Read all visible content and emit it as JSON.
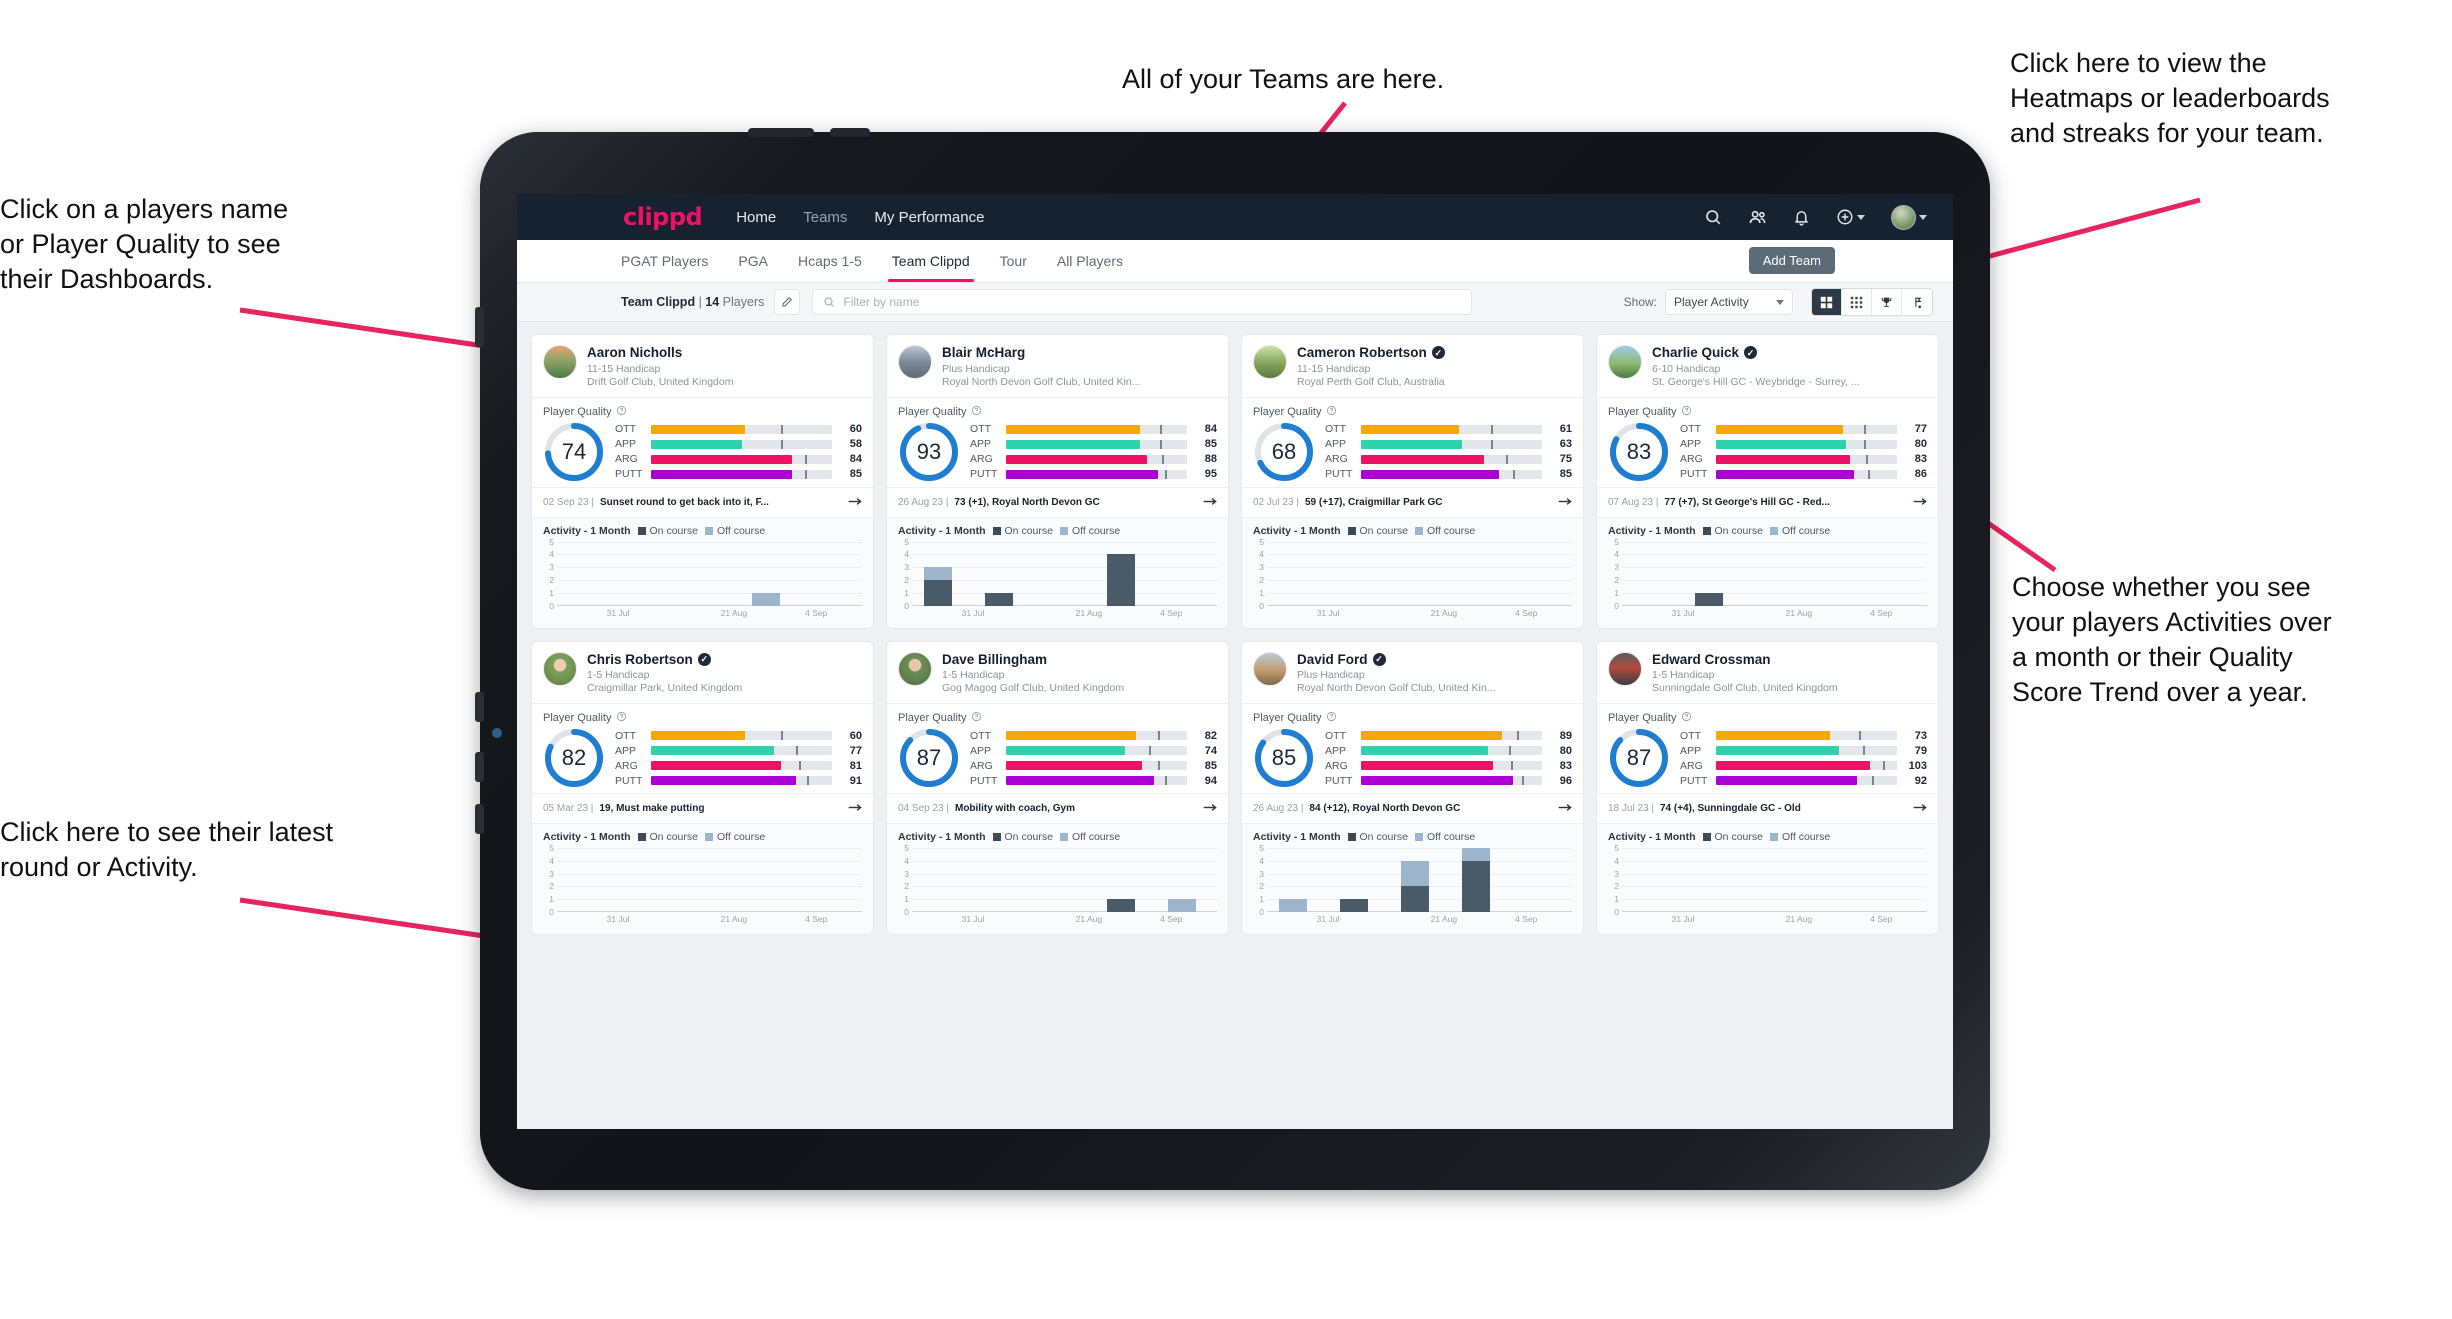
{
  "annotations": {
    "teams": "All of your Teams are here.",
    "heatmaps": "Click here to view the\nHeatmaps or leaderboards\nand streaks for your team.",
    "player_name": "Click on a players name\nor Player Quality to see\ntheir Dashboards.",
    "choose_view": "Choose whether you see\nyour players Activities over\na month or their Quality\nScore Trend over a year.",
    "latest_round": "Click here to see their latest\nround or Activity."
  },
  "topnav": {
    "logo": "clippd",
    "links": [
      {
        "label": "Home",
        "active": true
      },
      {
        "label": "Teams",
        "active": false
      },
      {
        "label": "My Performance",
        "active": true
      }
    ],
    "icons": [
      "search-icon",
      "people-icon",
      "bell-icon",
      "plus-circle-icon",
      "avatar"
    ]
  },
  "tabs": [
    {
      "label": "PGAT Players",
      "active": false
    },
    {
      "label": "PGA",
      "active": false
    },
    {
      "label": "Hcaps 1-5",
      "active": false
    },
    {
      "label": "Team Clippd",
      "active": true
    },
    {
      "label": "Tour",
      "active": false
    },
    {
      "label": "All Players",
      "active": false
    }
  ],
  "add_team_button": "Add Team",
  "filterbar": {
    "team_name": "Team Clippd",
    "separator": " | ",
    "player_count": "14",
    "players_word": " Players",
    "edit_icon": "pencil-icon",
    "search_placeholder": "Filter by name",
    "show_label": "Show:",
    "show_value": "Player Activity",
    "view_buttons": [
      "grid-view-icon",
      "dots-grid-icon",
      "trophy-icon",
      "flagstick-icon"
    ],
    "active_view": 0
  },
  "quality_label": "Player Quality",
  "activity_label": "Activity - 1 Month",
  "legend": {
    "on": "On course",
    "off": "Off course"
  },
  "bar_colors": {
    "OTT": "#f5a800",
    "APP": "#2fd2ac",
    "ARG": "#ef1164",
    "PUTT": "#aa00d4"
  },
  "accent": "#ef1164",
  "ring_color": "#1f7ed0",
  "chart_axis": {
    "yticks": [
      0,
      1,
      2,
      3,
      4,
      5
    ],
    "xticks": [
      "31 Jul",
      "21 Aug",
      "4 Sep"
    ]
  },
  "players": [
    {
      "name": "Aaron Nicholls",
      "verified": false,
      "handicap": "11-15 Handicap",
      "club": "Drift Golf Club, United Kingdom",
      "quality": 74,
      "metrics": [
        {
          "label": "OTT",
          "value": 60,
          "fill": 52,
          "tick": 72
        },
        {
          "label": "APP",
          "value": 58,
          "fill": 50,
          "tick": 72
        },
        {
          "label": "ARG",
          "value": 84,
          "fill": 78,
          "tick": 85
        },
        {
          "label": "PUTT",
          "value": 85,
          "fill": 78,
          "tick": 85
        }
      ],
      "round_date": "02 Sep 23",
      "round_text": "Sunset round to get back into it, F...",
      "activity": [
        {
          "on": 0,
          "off": 0
        },
        {
          "on": 0,
          "off": 0
        },
        {
          "on": 0,
          "off": 0
        },
        {
          "on": 0,
          "off": 1
        },
        {
          "on": 0,
          "off": 0
        }
      ]
    },
    {
      "name": "Blair McHarg",
      "verified": false,
      "handicap": "Plus Handicap",
      "club": "Royal North Devon Golf Club, United Kin...",
      "quality": 93,
      "metrics": [
        {
          "label": "OTT",
          "value": 84,
          "fill": 74,
          "tick": 85
        },
        {
          "label": "APP",
          "value": 85,
          "fill": 74,
          "tick": 85
        },
        {
          "label": "ARG",
          "value": 88,
          "fill": 78,
          "tick": 86
        },
        {
          "label": "PUTT",
          "value": 95,
          "fill": 84,
          "tick": 88
        }
      ],
      "round_date": "26 Aug 23",
      "round_text": "73 (+1), Royal North Devon GC",
      "activity": [
        {
          "on": 2,
          "off": 1
        },
        {
          "on": 1,
          "off": 0
        },
        {
          "on": 0,
          "off": 0
        },
        {
          "on": 4,
          "off": 0
        },
        {
          "on": 0,
          "off": 0
        }
      ]
    },
    {
      "name": "Cameron Robertson",
      "verified": true,
      "handicap": "11-15 Handicap",
      "club": "Royal Perth Golf Club, Australia",
      "quality": 68,
      "metrics": [
        {
          "label": "OTT",
          "value": 61,
          "fill": 54,
          "tick": 72
        },
        {
          "label": "APP",
          "value": 63,
          "fill": 56,
          "tick": 72
        },
        {
          "label": "ARG",
          "value": 75,
          "fill": 68,
          "tick": 80
        },
        {
          "label": "PUTT",
          "value": 85,
          "fill": 76,
          "tick": 84
        }
      ],
      "round_date": "02 Jul 23",
      "round_text": "59 (+17), Craigmillar Park GC",
      "activity": [
        {
          "on": 0,
          "off": 0
        },
        {
          "on": 0,
          "off": 0
        },
        {
          "on": 0,
          "off": 0
        },
        {
          "on": 0,
          "off": 0
        },
        {
          "on": 0,
          "off": 0
        }
      ]
    },
    {
      "name": "Charlie Quick",
      "verified": true,
      "handicap": "6-10 Handicap",
      "club": "St. George's Hill GC - Weybridge - Surrey, ...",
      "quality": 83,
      "metrics": [
        {
          "label": "OTT",
          "value": 77,
          "fill": 70,
          "tick": 82
        },
        {
          "label": "APP",
          "value": 80,
          "fill": 72,
          "tick": 82
        },
        {
          "label": "ARG",
          "value": 83,
          "fill": 74,
          "tick": 83
        },
        {
          "label": "PUTT",
          "value": 86,
          "fill": 76,
          "tick": 84
        }
      ],
      "round_date": "07 Aug 23",
      "round_text": "77 (+7), St George's Hill GC - Red...",
      "activity": [
        {
          "on": 0,
          "off": 0
        },
        {
          "on": 1,
          "off": 0
        },
        {
          "on": 0,
          "off": 0
        },
        {
          "on": 0,
          "off": 0
        },
        {
          "on": 0,
          "off": 0
        }
      ]
    },
    {
      "name": "Chris Robertson",
      "verified": true,
      "handicap": "1-5 Handicap",
      "club": "Craigmillar Park, United Kingdom",
      "quality": 82,
      "metrics": [
        {
          "label": "OTT",
          "value": 60,
          "fill": 52,
          "tick": 72
        },
        {
          "label": "APP",
          "value": 77,
          "fill": 68,
          "tick": 80
        },
        {
          "label": "ARG",
          "value": 81,
          "fill": 72,
          "tick": 82
        },
        {
          "label": "PUTT",
          "value": 91,
          "fill": 80,
          "tick": 86
        }
      ],
      "round_date": "05 Mar 23",
      "round_text": "19, Must make putting",
      "activity": [
        {
          "on": 0,
          "off": 0
        },
        {
          "on": 0,
          "off": 0
        },
        {
          "on": 0,
          "off": 0
        },
        {
          "on": 0,
          "off": 0
        },
        {
          "on": 0,
          "off": 0
        }
      ]
    },
    {
      "name": "Dave Billingham",
      "verified": false,
      "handicap": "1-5 Handicap",
      "club": "Gog Magog Golf Club, United Kingdom",
      "quality": 87,
      "metrics": [
        {
          "label": "OTT",
          "value": 82,
          "fill": 72,
          "tick": 84
        },
        {
          "label": "APP",
          "value": 74,
          "fill": 66,
          "tick": 79
        },
        {
          "label": "ARG",
          "value": 85,
          "fill": 75,
          "tick": 84
        },
        {
          "label": "PUTT",
          "value": 94,
          "fill": 82,
          "tick": 88
        }
      ],
      "round_date": "04 Sep 23",
      "round_text": "Mobility with coach, Gym",
      "activity": [
        {
          "on": 0,
          "off": 0
        },
        {
          "on": 0,
          "off": 0
        },
        {
          "on": 0,
          "off": 0
        },
        {
          "on": 1,
          "off": 0
        },
        {
          "on": 0,
          "off": 1
        }
      ]
    },
    {
      "name": "David Ford",
      "verified": true,
      "handicap": "Plus Handicap",
      "club": "Royal North Devon Golf Club, United Kin...",
      "quality": 85,
      "metrics": [
        {
          "label": "OTT",
          "value": 89,
          "fill": 78,
          "tick": 86
        },
        {
          "label": "APP",
          "value": 80,
          "fill": 70,
          "tick": 82
        },
        {
          "label": "ARG",
          "value": 83,
          "fill": 73,
          "tick": 83
        },
        {
          "label": "PUTT",
          "value": 96,
          "fill": 84,
          "tick": 89
        }
      ],
      "round_date": "26 Aug 23",
      "round_text": "84 (+12), Royal North Devon GC",
      "activity": [
        {
          "on": 0,
          "off": 1
        },
        {
          "on": 1,
          "off": 0
        },
        {
          "on": 2,
          "off": 2
        },
        {
          "on": 4,
          "off": 1
        },
        {
          "on": 0,
          "off": 0
        }
      ]
    },
    {
      "name": "Edward Crossman",
      "verified": false,
      "handicap": "1-5 Handicap",
      "club": "Sunningdale Golf Club, United Kingdom",
      "quality": 87,
      "metrics": [
        {
          "label": "OTT",
          "value": 73,
          "fill": 63,
          "tick": 79
        },
        {
          "label": "APP",
          "value": 79,
          "fill": 68,
          "tick": 81
        },
        {
          "label": "ARG",
          "value": 103,
          "fill": 85,
          "tick": 92
        },
        {
          "label": "PUTT",
          "value": 92,
          "fill": 78,
          "tick": 86
        }
      ],
      "round_date": "18 Jul 23",
      "round_text": "74 (+4), Sunningdale GC - Old",
      "activity": [
        {
          "on": 0,
          "off": 0
        },
        {
          "on": 0,
          "off": 0
        },
        {
          "on": 0,
          "off": 0
        },
        {
          "on": 0,
          "off": 0
        },
        {
          "on": 0,
          "off": 0
        }
      ]
    }
  ]
}
